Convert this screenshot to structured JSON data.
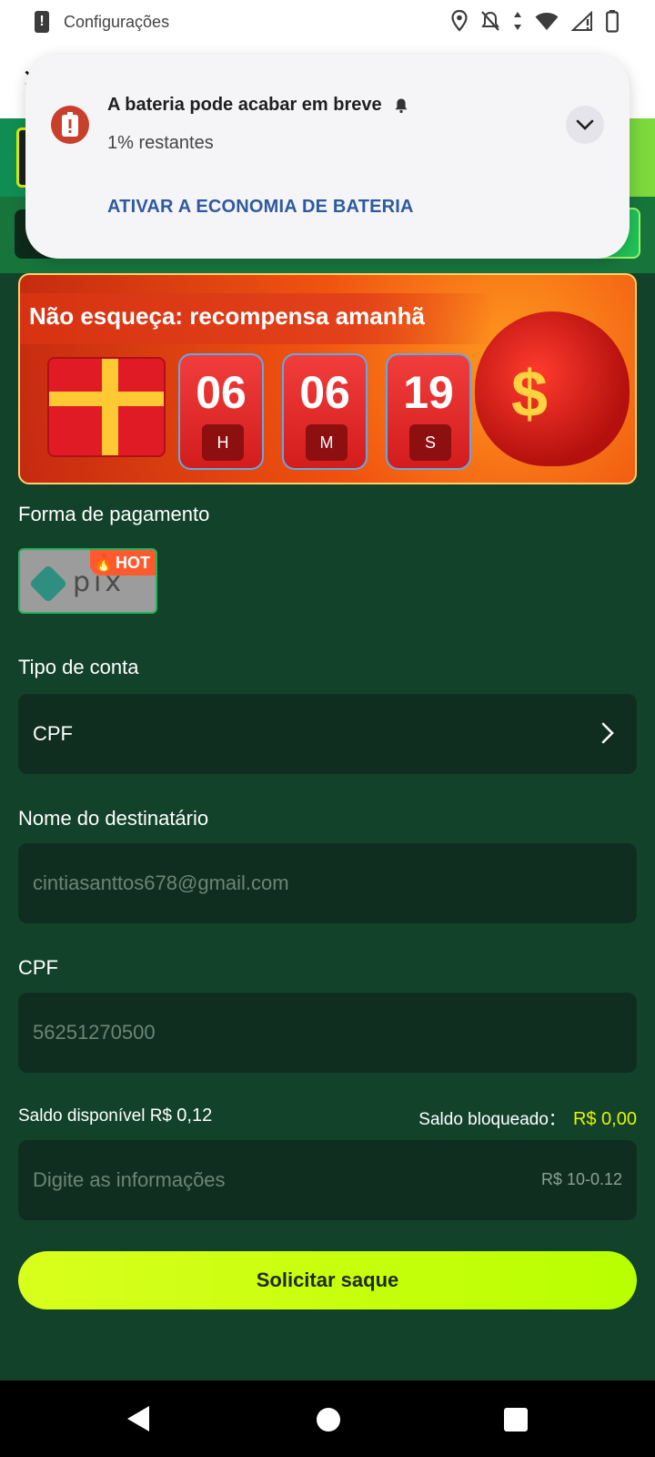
{
  "status_bar": {
    "app_label": "Configurações",
    "icons": [
      "alert-icon",
      "location-icon",
      "do-not-disturb-bell-icon",
      "data-arrows-icon",
      "wifi-icon",
      "signal-icon",
      "battery-icon"
    ]
  },
  "notification": {
    "title": "A bateria pode acabar em breve",
    "subtitle": "1% restantes",
    "action": "ATIVAR A ECONOMIA DE BATERIA",
    "icon": "battery-alert-icon",
    "accent_color": "#c8402b",
    "action_color": "#2d5aa1"
  },
  "promo": {
    "title": "Não esqueça: recompensa amanhã",
    "timer": [
      {
        "value": "06",
        "unit": "H"
      },
      {
        "value": "06",
        "unit": "M"
      },
      {
        "value": "19",
        "unit": "S"
      }
    ]
  },
  "payment": {
    "label": "Forma de pagamento",
    "method_badge": "HOT",
    "method_icon": "pix-logo-icon"
  },
  "account_type": {
    "label": "Tipo de conta",
    "value": "CPF"
  },
  "recipient": {
    "label": "Nome do destinatário",
    "placeholder": "cintiasanttos678@gmail.com"
  },
  "cpf": {
    "label": "CPF",
    "placeholder": "56251270500"
  },
  "balance": {
    "available_label": "Saldo disponível R$",
    "available_value": "0,12",
    "blocked_label": "Saldo bloqueado：",
    "blocked_value": "R$ 0,00"
  },
  "amount": {
    "placeholder": "Digite as informações",
    "hint": "R$ 10-0.12"
  },
  "submit_label": "Solicitar saque",
  "colors": {
    "background": "#12432a",
    "field": "#0f2e20",
    "button": "#c6ff00",
    "blocked_amount": "#e5f400"
  }
}
